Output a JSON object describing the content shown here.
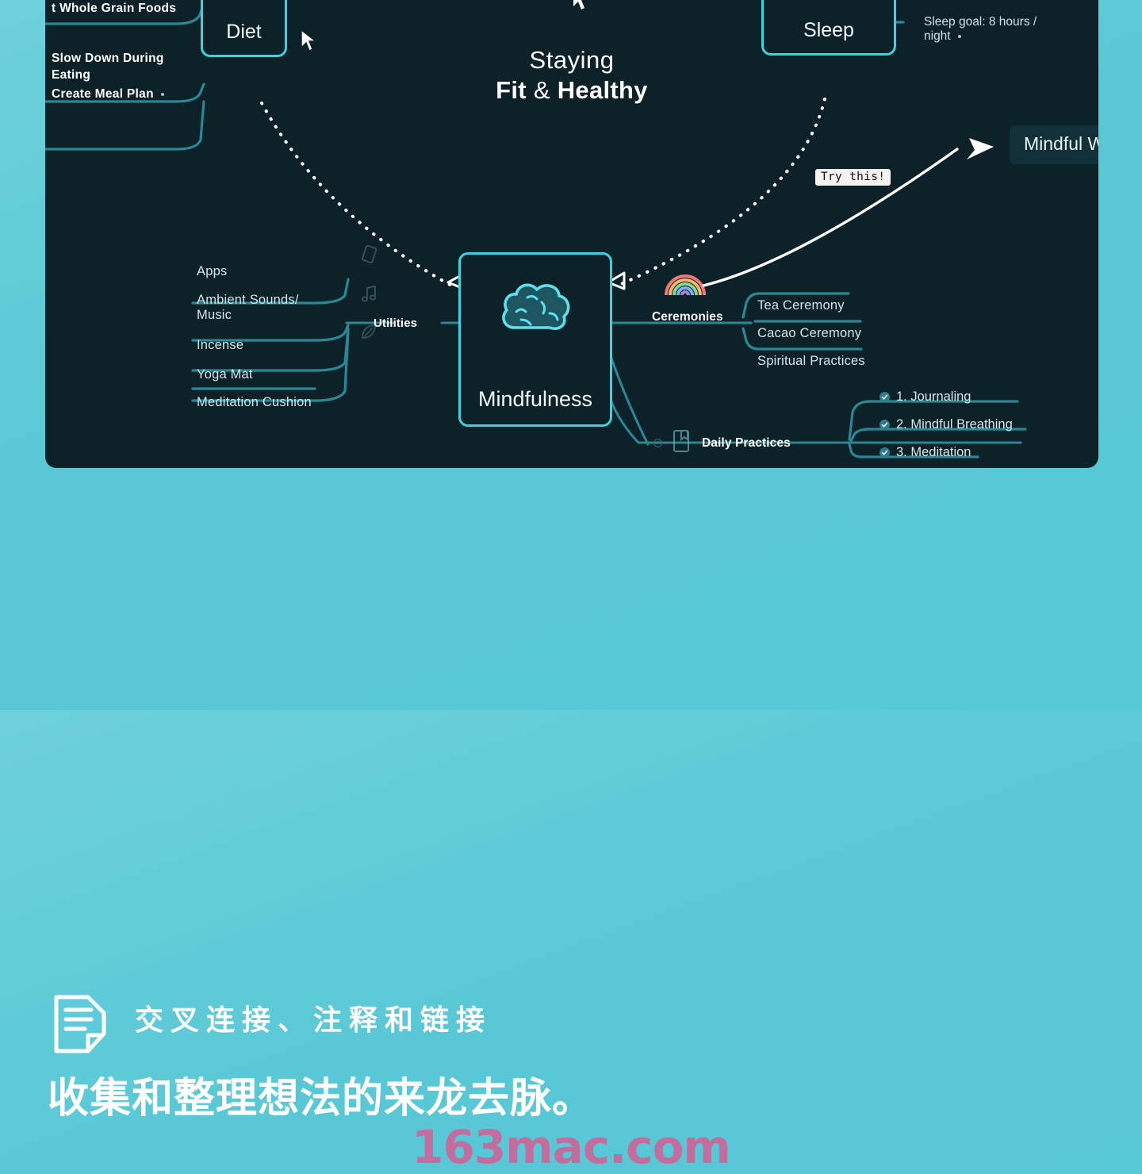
{
  "canvas": {
    "title_line1": "Staying",
    "title_line2_strong_a": "Fit",
    "title_line2_amp": "&",
    "title_line2_strong_b": "Healthy",
    "background_color": "#0d2128",
    "accent_color": "#38d4e3",
    "branch_color": "#2a8794"
  },
  "nodes": {
    "diet": {
      "label": "Diet",
      "icon": "apple-icon"
    },
    "sleep": {
      "label": "Sleep",
      "icon": "moon-star-icon"
    },
    "mindfulness": {
      "label": "Mindfulness",
      "icon": "brain-icon"
    }
  },
  "diet_branch": {
    "items": [
      {
        "label": "t Whole Grain Foods",
        "has_dot": false
      },
      {
        "label": "Slow Down During\nEating",
        "has_dot": false
      },
      {
        "label": "Create Meal Plan",
        "has_dot": true
      }
    ]
  },
  "sleep_branch": {
    "items": [
      {
        "label": "Sleep goal: 8 hours /\nnight",
        "has_dot": true
      }
    ]
  },
  "utilities": {
    "label": "Utilities",
    "items": [
      {
        "label": "Apps",
        "icon": "phone-icon"
      },
      {
        "label": "Ambient Sounds/\nMusic",
        "icon": "music-note-icon"
      },
      {
        "label": "Incense",
        "icon": "leaf-icon"
      },
      {
        "label": "Yoga Mat",
        "icon": null
      },
      {
        "label": "Meditation Cushion",
        "icon": null
      }
    ]
  },
  "ceremonies": {
    "label": "Ceremonies",
    "icon": "rainbow-icon",
    "items": [
      {
        "label": "Tea Ceremony"
      },
      {
        "label": "Cacao Ceremony"
      },
      {
        "label": "Spiritual Practices"
      }
    ]
  },
  "daily_practices": {
    "label": "Daily Practices",
    "icon": "notebook-icon",
    "items": [
      {
        "label": "1. Journaling",
        "checked": true
      },
      {
        "label": "2. Mindful Breathing",
        "checked": true
      },
      {
        "label": "3. Meditation",
        "checked": true
      }
    ]
  },
  "annotation": {
    "callout": "Try this!",
    "linked_card": "Mindful  W"
  },
  "bottom": {
    "icon": "document-lines-icon",
    "heading": "交叉连接、注释和链接",
    "subheading": "收集和整理想法的来龙去脉。",
    "watermark": "163mac.com",
    "watermark_color": "#cc6699"
  }
}
